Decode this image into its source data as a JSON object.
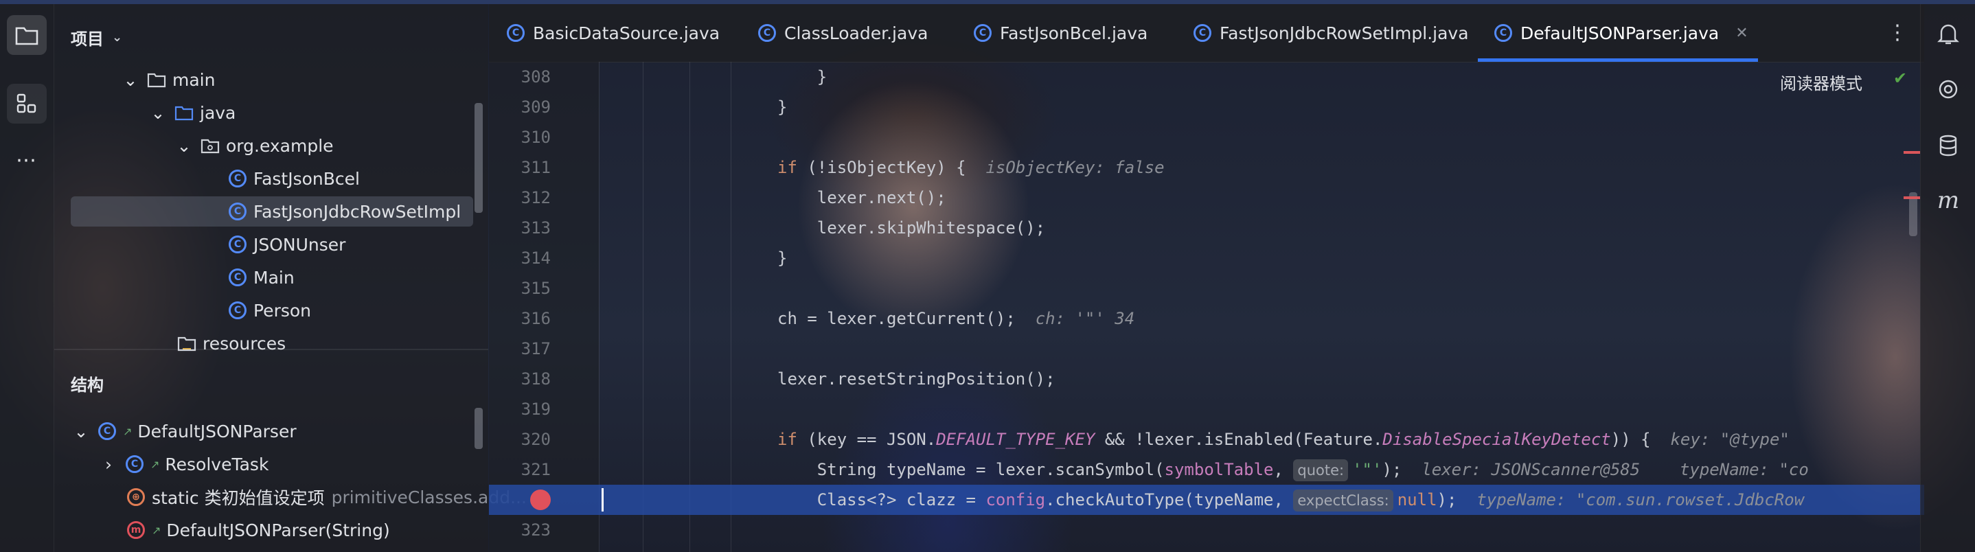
{
  "project_panel": {
    "title": "项目",
    "tree": [
      {
        "label": "main"
      },
      {
        "label": "java"
      },
      {
        "label": "org.example"
      },
      {
        "label": "FastJsonBcel"
      },
      {
        "label": "FastJsonJdbcRowSetImpl"
      },
      {
        "label": "JSONUnser"
      },
      {
        "label": "Main"
      },
      {
        "label": "Person"
      },
      {
        "label": "resources"
      }
    ]
  },
  "structure_panel": {
    "title": "结构",
    "items": [
      {
        "label": "DefaultJSONParser"
      },
      {
        "label": "ResolveTask"
      },
      {
        "label": "static 类初始值设定项",
        "suffix": "primitiveClasses.add..."
      },
      {
        "label": "DefaultJSONParser(String)"
      }
    ]
  },
  "tabs": [
    {
      "label": "BasicDataSource.java"
    },
    {
      "label": "ClassLoader.java"
    },
    {
      "label": "FastJsonBcel.java"
    },
    {
      "label": "FastJsonJdbcRowSetImpl.java"
    },
    {
      "label": "DefaultJSONParser.java",
      "active": true
    }
  ],
  "editor": {
    "reader_mode": "阅读器模式",
    "line_numbers": [
      "308",
      "309",
      "310",
      "311",
      "312",
      "313",
      "314",
      "315",
      "316",
      "317",
      "318",
      "319",
      "320",
      "321",
      "322",
      "323"
    ],
    "code": {
      "l308": "    }",
      "l309": "}",
      "l311_kw": "if",
      "l311": " (!isObjectKey) {",
      "l311_hint": "isObjectKey: false",
      "l312": "    lexer.next();",
      "l313": "    lexer.skipWhitespace();",
      "l314": "}",
      "l316": "ch = lexer.getCurrent();",
      "l316_hint": "ch: '\"' 34",
      "l318": "lexer.resetStringPosition();",
      "l320_kw": "if",
      "l320_a": " (key == JSON.",
      "l320_const": "DEFAULT_TYPE_KEY",
      "l320_b": " && !lexer.isEnabled(Feature.",
      "l320_const2": "DisableSpecialKeyDetect",
      "l320_c": ")) {",
      "l320_hint": "key: \"@type\"",
      "l321_a": "    String typeName = lexer.scanSymbol(",
      "l321_field": "symbolTable",
      "l321_b": ", ",
      "l321_inlay": "quote:",
      "l321_str": "'\"'",
      "l321_c": ");",
      "l321_hint": "lexer: JSONScanner@585    typeName: \"co",
      "l322_a": "    Class<?> clazz = ",
      "l322_field": "config",
      "l322_b": ".checkAutoType(typeName, ",
      "l322_inlay": "expectClass:",
      "l322_kw": "null",
      "l322_c": ");",
      "l322_hint": "typeName: \"com.sun.rowset.JdbcRow"
    }
  },
  "colors": {
    "accent": "#3574f0",
    "keyword": "#cf8e6d",
    "constant": "#c77dbb",
    "string": "#6aab73",
    "breakpoint": "#e0515b"
  }
}
